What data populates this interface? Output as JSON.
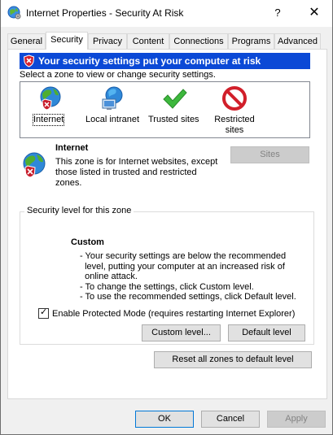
{
  "window": {
    "title": "Internet Properties - Security At Risk",
    "help_label": "?",
    "close_label": "✕"
  },
  "tabs": [
    {
      "label": "General",
      "active": false
    },
    {
      "label": "Security",
      "active": true
    },
    {
      "label": "Privacy",
      "active": false
    },
    {
      "label": "Content",
      "active": false
    },
    {
      "label": "Connections",
      "active": false
    },
    {
      "label": "Programs",
      "active": false
    },
    {
      "label": "Advanced",
      "active": false
    }
  ],
  "alert": {
    "text": "Your security settings put your computer at risk",
    "background": "#0b49d6"
  },
  "zones": {
    "prompt": "Select a zone to view or change security settings.",
    "items": [
      {
        "label": "Internet",
        "icon": "globe-shield-icon",
        "selected": true
      },
      {
        "label": "Local intranet",
        "icon": "network-globe-icon",
        "selected": false
      },
      {
        "label": "Trusted sites",
        "icon": "checkmark-icon",
        "selected": false
      },
      {
        "label": "Restricted sites",
        "icon": "restricted-icon",
        "selected": false
      }
    ]
  },
  "zone_description": {
    "title": "Internet",
    "body": "This zone is for Internet websites, except those listed in trusted and restricted zones.",
    "sites_button": "Sites"
  },
  "security_level": {
    "group_title": "Security level for this zone",
    "level_name": "Custom",
    "lines": [
      "- Your security settings are below the recommended",
      "  level, putting your computer at an increased risk of",
      "  online attack.",
      "- To change the settings, click Custom level.",
      "- To use the recommended settings, click Default level."
    ],
    "protected_mode_label": "Enable Protected Mode (requires restarting Internet Explorer)",
    "protected_mode_checked": true,
    "custom_level_button": "Custom level...",
    "default_level_button": "Default level"
  },
  "reset_button": "Reset all zones to default level",
  "footer": {
    "ok": "OK",
    "cancel": "Cancel",
    "apply": "Apply"
  }
}
